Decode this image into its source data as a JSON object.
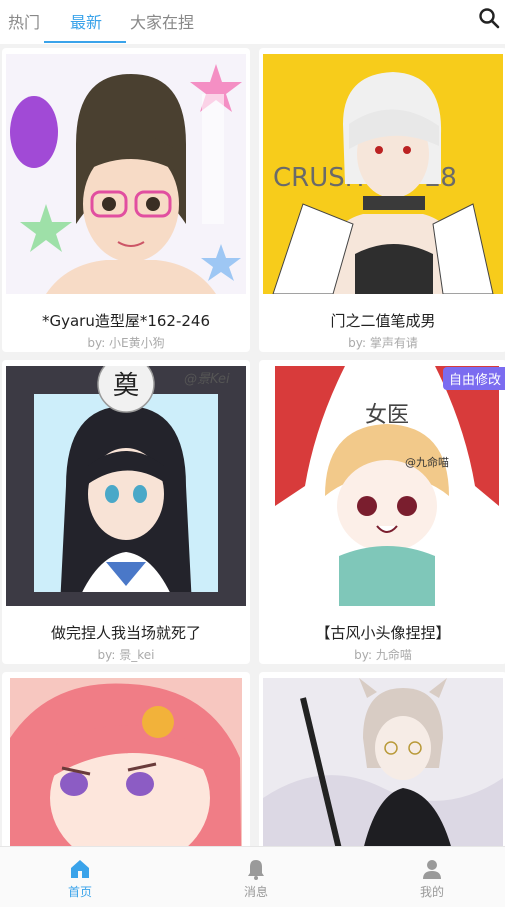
{
  "tabs": [
    {
      "label": "热门"
    },
    {
      "label": "最新"
    },
    {
      "label": "大家在捏"
    }
  ],
  "active_tab": "最新",
  "search_icon": "search-icon",
  "accent_color": "#3aa3ea",
  "cards": [
    {
      "title": "*Gyaru造型屋*162-246",
      "author": "by: 小E黄小狗"
    },
    {
      "title": "门之二值笔成男",
      "author": "by: 掌声有请",
      "image_text": "CRUSH LOVE8"
    },
    {
      "title": "做完捏人我当场就死了",
      "author": "by: 景_kei",
      "image_text": "@景Kei"
    },
    {
      "title": "【古风小头像捏捏】",
      "author": "by: 九命喵",
      "badge": "自由修改",
      "image_text": "@九命喵"
    },
    {
      "title": "",
      "author": ""
    },
    {
      "title": "",
      "author": ""
    }
  ],
  "bottom_nav": [
    {
      "label": "首页",
      "icon": "home-icon"
    },
    {
      "label": "消息",
      "icon": "bell-icon"
    },
    {
      "label": "我的",
      "icon": "user-icon"
    }
  ]
}
